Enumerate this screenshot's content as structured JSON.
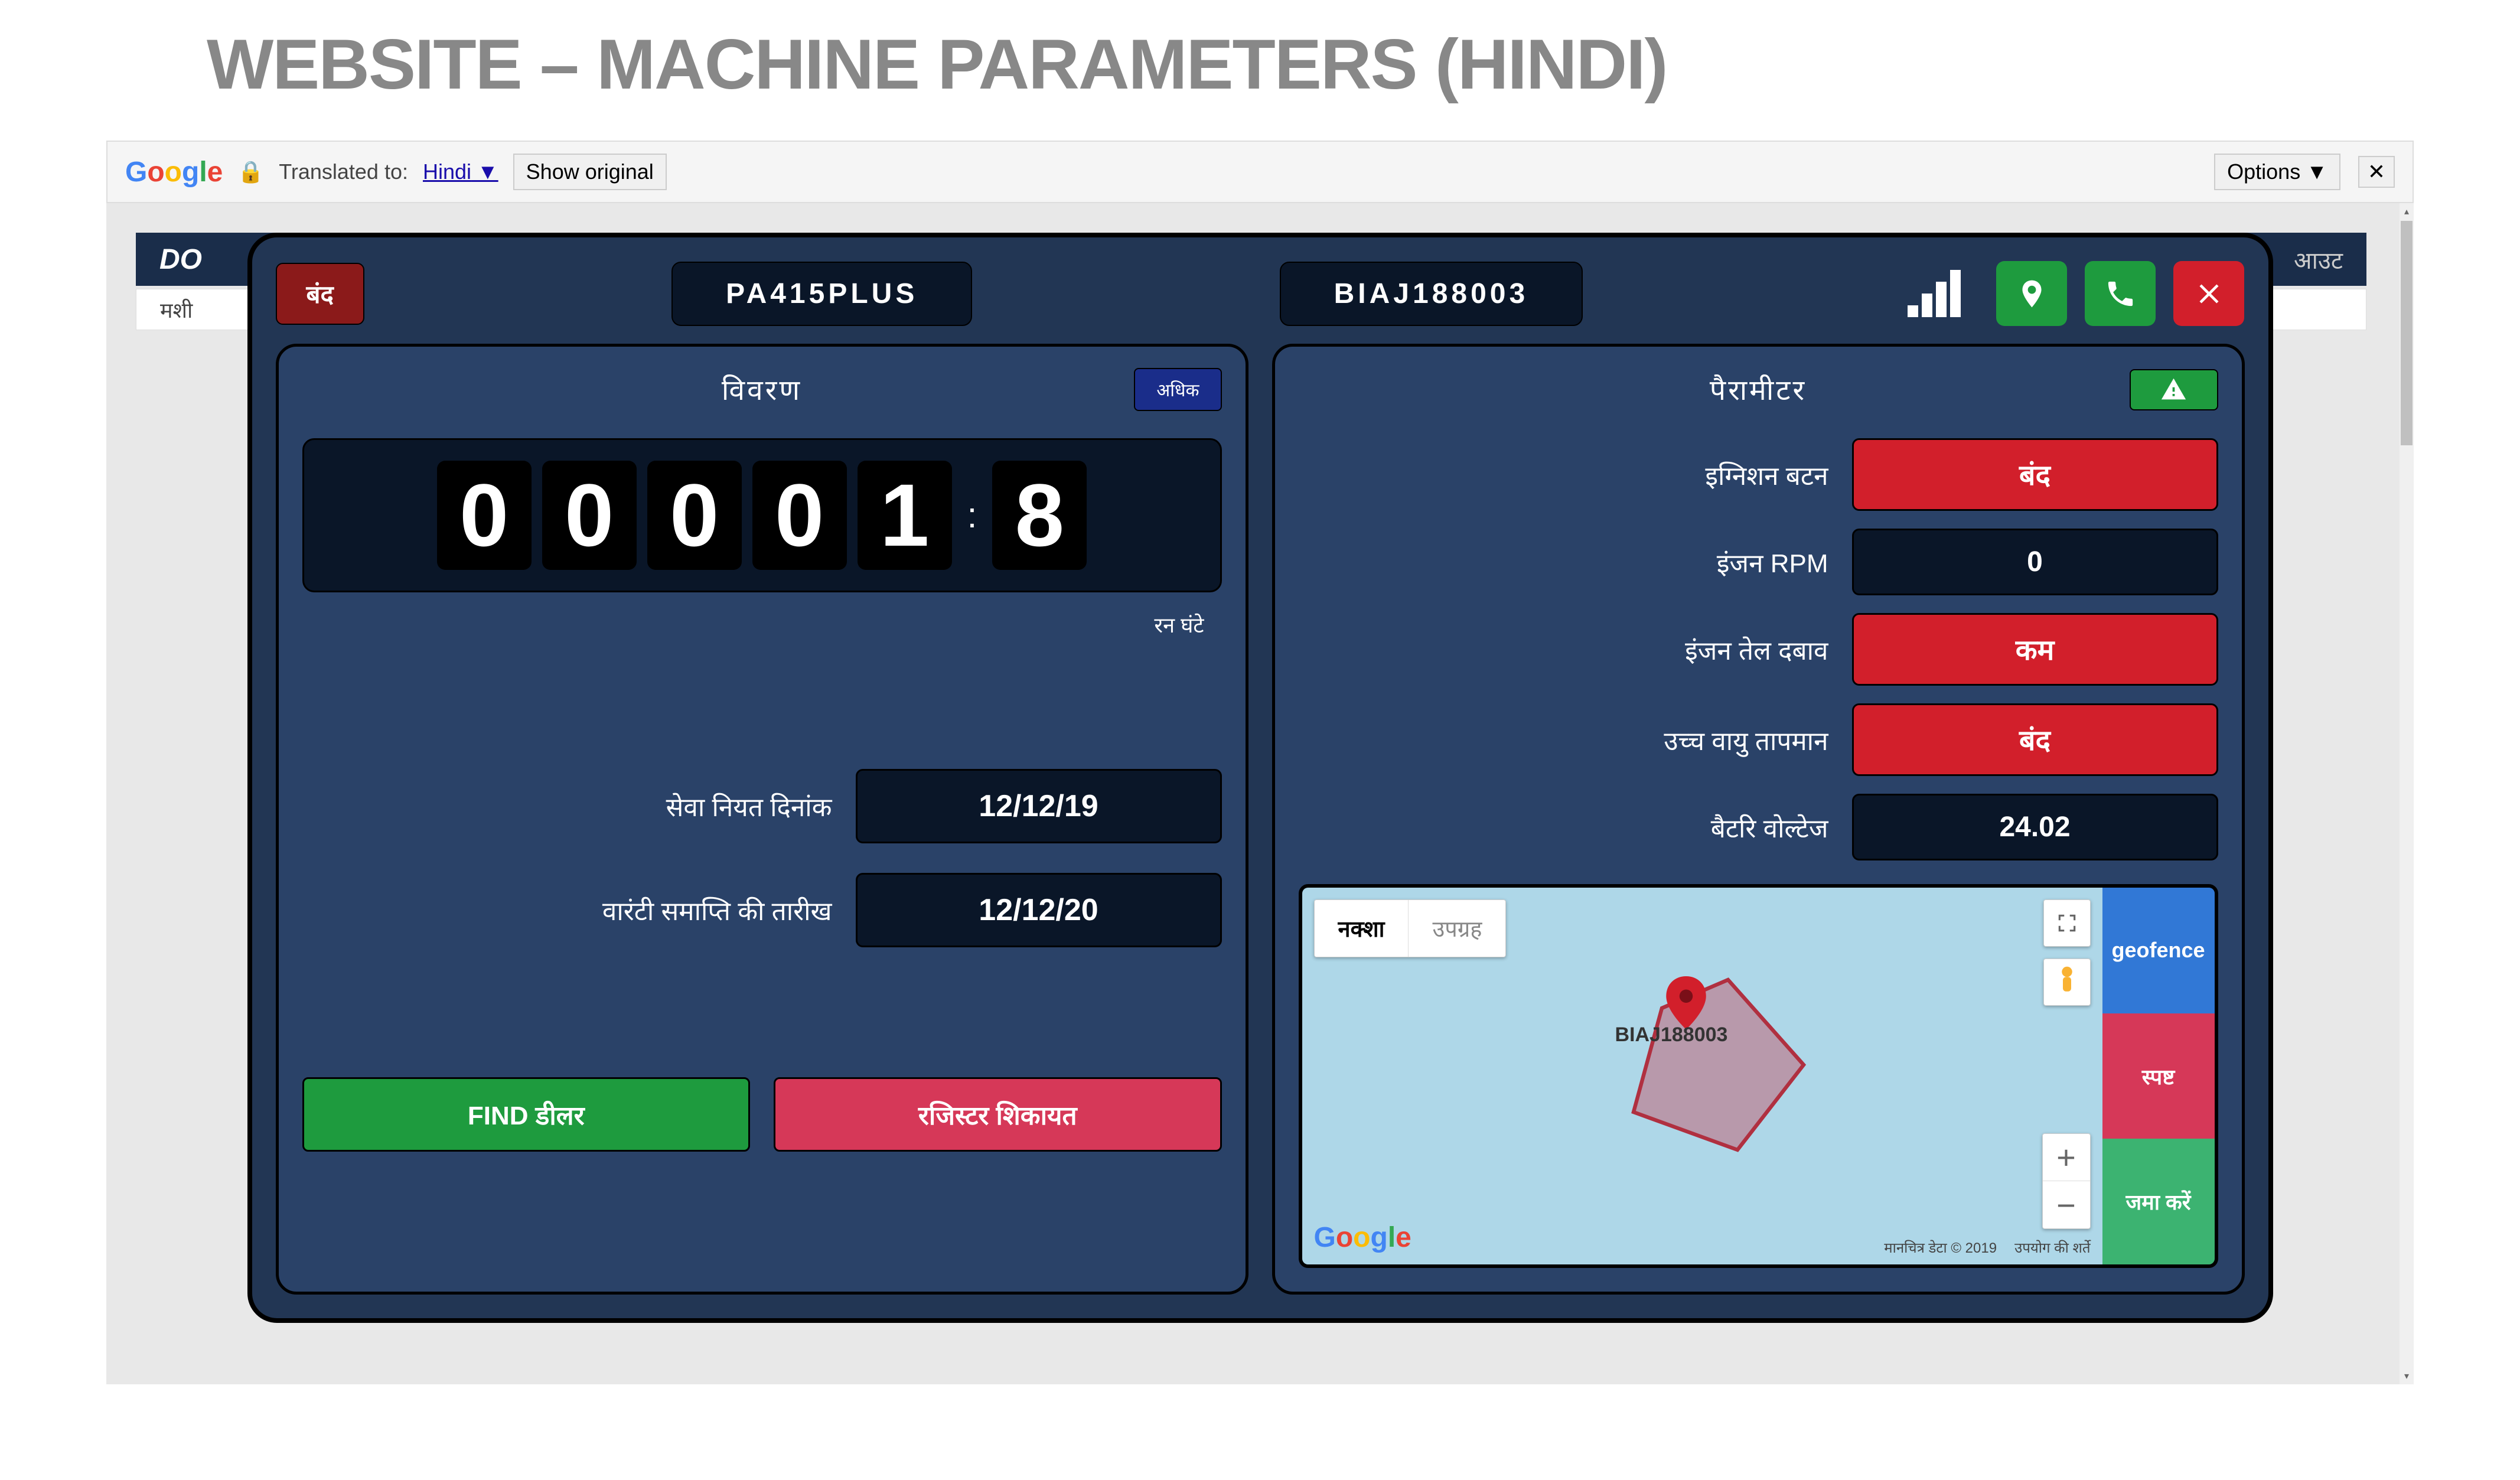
{
  "slideTitle": "WEBSITE – MACHINE PARAMETERS (HINDI)",
  "translateBar": {
    "translatedTo": "Translated to:",
    "language": "Hindi",
    "showOriginal": "Show original",
    "options": "Options ▼",
    "close": "✕"
  },
  "bgHeader": {
    "logo": "DO",
    "logout": "आउट"
  },
  "bgNav": {
    "item": "मशी"
  },
  "modalHeader": {
    "closeLabel": "बंद",
    "model": "PA415PLUS",
    "serial": "BIAJ188003"
  },
  "leftPanel": {
    "title": "विवरण",
    "moreLabel": "अधिक",
    "odometer": [
      "0",
      "0",
      "0",
      "0",
      "1",
      "8"
    ],
    "odometerLabel": "रन घंटे",
    "serviceDateLabel": "सेवा नियत दिनांक",
    "serviceDate": "12/12/19",
    "warrantyLabel": "वारंटी समाप्ति की तारीख",
    "warrantyDate": "12/12/20",
    "findDealer": "FIND डीलर",
    "registerComplaint": "रजिस्टर शिकायत"
  },
  "rightPanel": {
    "title": "पैरामीटर",
    "params": [
      {
        "label": "इग्निशन बटन",
        "value": "बंद",
        "style": "red"
      },
      {
        "label": "इंजन RPM",
        "value": "0",
        "style": "dark"
      },
      {
        "label": "इंजन तेल दबाव",
        "value": "कम",
        "style": "red"
      },
      {
        "label": "उच्च वायु तापमान",
        "value": "बंद",
        "style": "red"
      },
      {
        "label": "बैटरि वोल्टेज",
        "value": "24.02",
        "style": "dark"
      }
    ],
    "map": {
      "tabs": {
        "map": "नक्शा",
        "satellite": "उपग्रह"
      },
      "markerLabel": "BIAJ188003",
      "attribution": "मानचित्र डेटा © 2019",
      "terms": "उपयोग की शर्ते",
      "sidebar": {
        "geofence": "geofence",
        "clear": "स्पष्ट",
        "save": "जमा करें"
      }
    }
  }
}
